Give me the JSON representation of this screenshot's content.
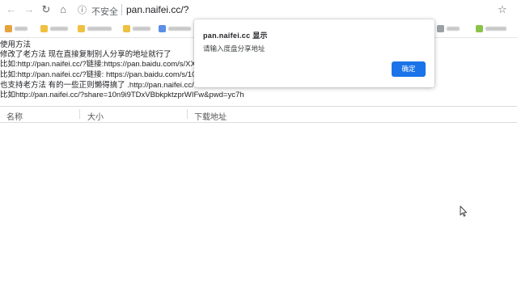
{
  "browser": {
    "security_label": "不安全",
    "url": "pan.naifei.cc/?"
  },
  "icons": {
    "back": "arrow-left-icon",
    "forward": "arrow-right-icon",
    "reload": "reload-icon",
    "home": "home-icon",
    "info": "info-icon",
    "star": "star-icon",
    "cursor": "mouse-cursor-icon"
  },
  "page": {
    "lines": [
      "使用方法",
      "修改了老方法 现在直接复制别人分享的地址就行了",
      "比如:http://pan.naifei.cc/?链接:https://pan.baidu.com/s/XXX",
      "比如:http://pan.naifei.cc/?链接: https://pan.baidu.com/s/10",
      "也支持老方法 有的一些正则懒得搞了 .http://pan.naifei.cc/?s",
      "比如http://pan.naifei.cc/?share=10n9i9TDxVBbkpktzprWIFw&pwd=yc7h"
    ],
    "table_headers": [
      "名称",
      "大小",
      "下载地址"
    ]
  },
  "dialog": {
    "title": "pan.naifei.cc 显示",
    "message": "请输入度盘分享地址",
    "ok_label": "确定"
  },
  "colors": {
    "button_blue": "#1a73e8"
  }
}
